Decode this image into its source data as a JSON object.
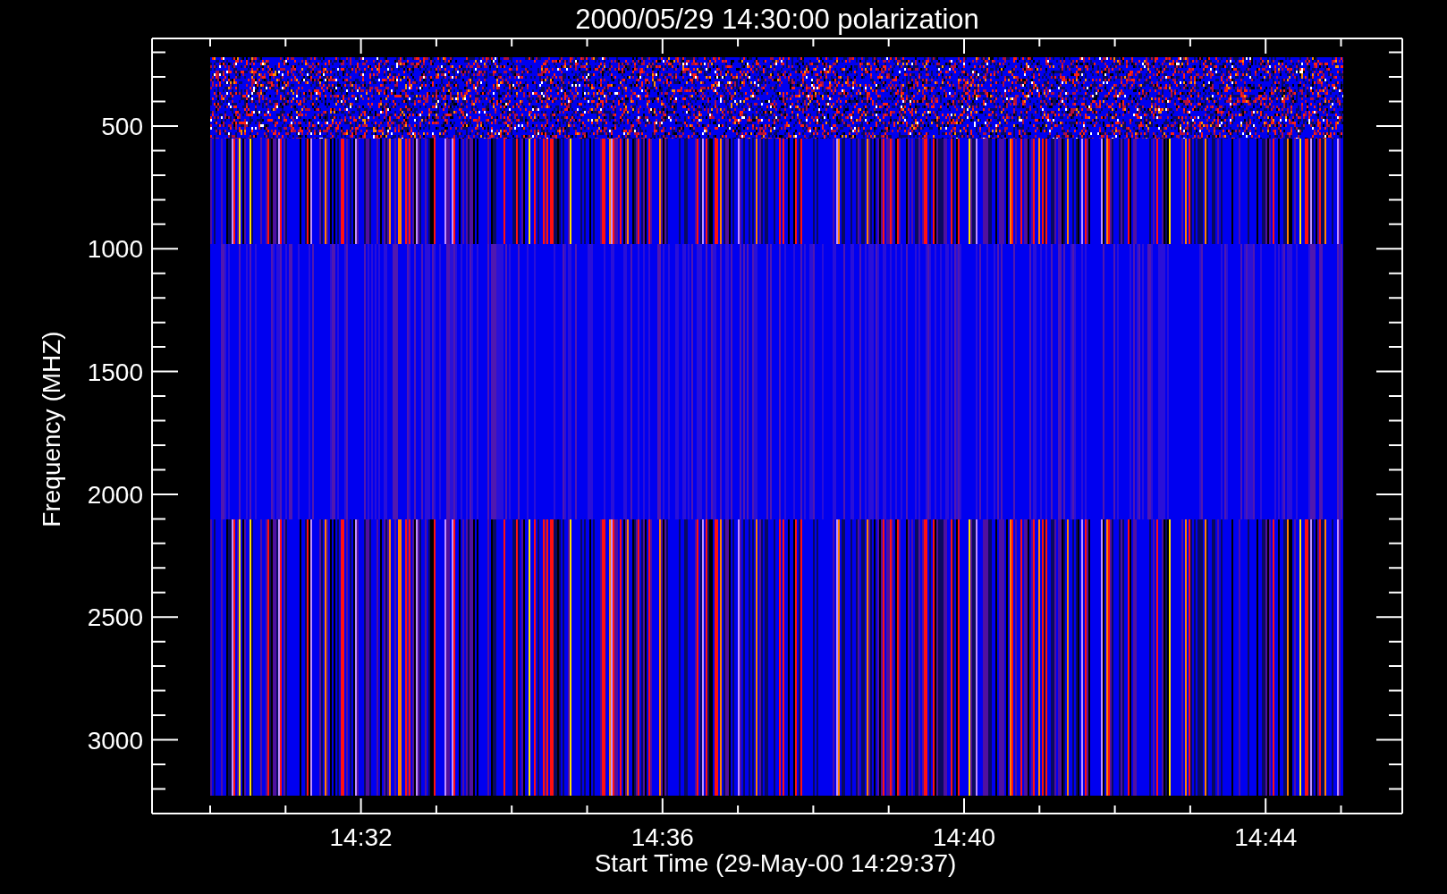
{
  "plot": {
    "title": "2000/05/29 14:30:00 polarization",
    "ylabel": "Frequency (MHZ)",
    "xlabel": "Start Time (29-May-00 14:29:37)",
    "yticks": [
      "500",
      "1000",
      "1500",
      "2000",
      "2500",
      "3000"
    ],
    "xticks": [
      "14:32",
      "14:36",
      "14:40",
      "14:44"
    ]
  }
}
